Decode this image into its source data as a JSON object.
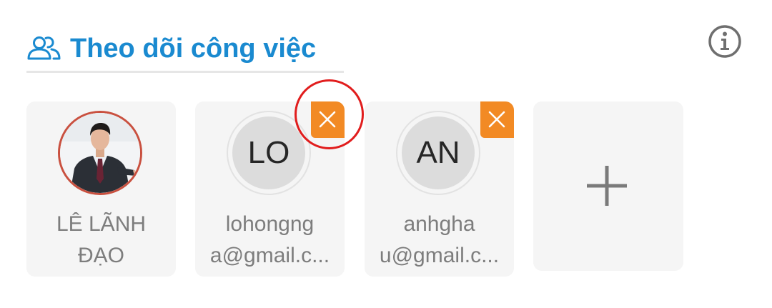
{
  "header": {
    "title": "Theo dõi công việc",
    "icon": "users-icon"
  },
  "info_button": {
    "icon": "info-icon"
  },
  "followers": [
    {
      "avatar_type": "photo",
      "name_line1": "LÊ LÃNH",
      "name_line2": "ĐẠO",
      "removable": false
    },
    {
      "avatar_type": "initials",
      "initials": "LO",
      "name_line1": "lohongng",
      "name_line2": "a@gmail.c...",
      "removable": true,
      "remove_icon": "close-icon"
    },
    {
      "avatar_type": "initials",
      "initials": "AN",
      "name_line1": "anhgha",
      "name_line2": "u@gmail.c...",
      "removable": true,
      "remove_icon": "close-icon"
    }
  ],
  "add_button": {
    "icon": "plus-icon"
  },
  "colors": {
    "accent": "#1a8ad0",
    "remove_badge": "#f28a24",
    "highlight": "#e11d1d",
    "card_bg": "#f5f5f5",
    "name_text": "#7d7d7d"
  }
}
